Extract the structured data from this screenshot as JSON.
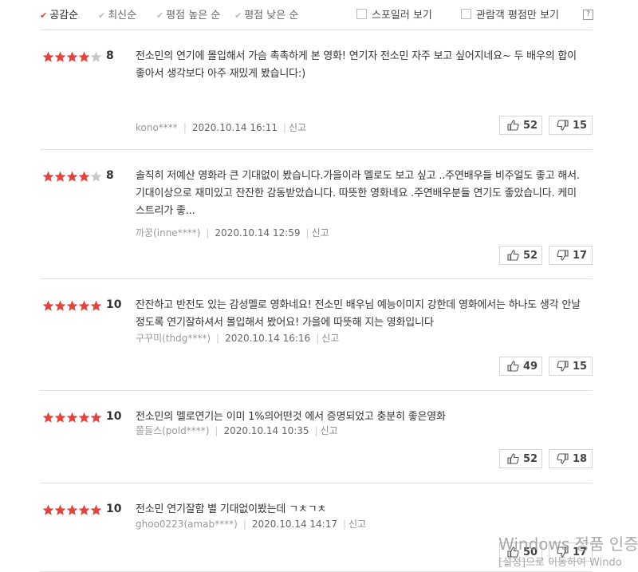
{
  "sort_options": [
    {
      "label": "공감순",
      "active": true
    },
    {
      "label": "최신순",
      "active": false
    },
    {
      "label": "평점 높은 순",
      "active": false
    },
    {
      "label": "평점 낮은 순",
      "active": false
    }
  ],
  "filters": {
    "spoiler_label": "스포일러 보기",
    "audience_only_label": "관람객 평점만 보기",
    "help_label": "?"
  },
  "colors": {
    "star_on": "#e8413b",
    "star_off": "#c8c8c8",
    "check_active": "#e8413b"
  },
  "report_label": "신고",
  "reviews": [
    {
      "rating": 4,
      "score": "8",
      "text": "전소민의 연기에 몰입해서 가슴 촉촉하게 본 영화! 연기자 전소민 자주 보고 싶어지네요~ 두 배우의 합이 좋아서 생각보다 아주 재밌게 봤습니다:)",
      "author": "kono****",
      "date": "2020.10.14 16:11",
      "likes": "52",
      "dislikes": "15"
    },
    {
      "rating": 4,
      "score": "8",
      "text": "솔직히 저예산 영화라 큰 기대없이 봤습니다.가을이라 멜로도 보고 싶고 ..주연배우들 비주얼도 좋고 해서.기대이상으로 재미있고 잔잔한 감동받았습니다. 따뜻한 영화네요 .주연배우분들 연기도 좋았습니다. 케미스트리가 좋...",
      "author": "까꿍(inne****)",
      "date": "2020.10.14 12:59",
      "likes": "52",
      "dislikes": "17"
    },
    {
      "rating": 5,
      "score": "10",
      "text": "잔잔하고 반전도 있는 감성멜로 영화네요! 전소민 배우님 예능이미지 강한데 영화에서는 하나도 생각 안날정도록 연기잘하셔서 몰입해서 봤어요! 가을에 따뜻해 지는 영화입니다",
      "author": "구꾸미(thdg****)",
      "date": "2020.10.14 16:16",
      "likes": "49",
      "dislikes": "15"
    },
    {
      "rating": 5,
      "score": "10",
      "text": "전소민의 멜로연기는 이미 1%의어떤것 에서 증명되었고 충분히 좋은영화",
      "author": "쫄들스(pold****)",
      "date": "2020.10.14 10:35",
      "likes": "52",
      "dislikes": "18"
    },
    {
      "rating": 5,
      "score": "10",
      "text": "전소민 연기잘함 별 기대없이봤는데 ㄱㅊㄱㅊ",
      "author": "ghoo0223(amab****)",
      "date": "2020.10.14 14:17",
      "likes": "50",
      "dislikes": "17"
    }
  ],
  "watermark": {
    "line1": "Windows 정품 인증",
    "line2": "[설정]으로 이동하여 Windo"
  }
}
